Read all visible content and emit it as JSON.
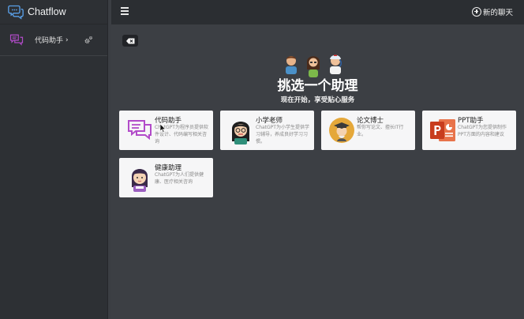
{
  "app": {
    "title": "Chatflow"
  },
  "sidebar": {
    "items": [
      {
        "label": "代码助手",
        "chevron": "›",
        "icon": "chat-bubbles-icon"
      }
    ]
  },
  "header": {
    "new_chat_label": "新的聊天"
  },
  "main": {
    "title": "挑选一个助理",
    "subtitle": "现在开始，享受贴心服务",
    "assistants": [
      {
        "name": "代码助手",
        "desc": "ChatGPT为程序员提供软件设计、代码编写相关咨询"
      },
      {
        "name": "小学老师",
        "desc": "ChatGPT为小学生提供学习辅导，养成良好学习习惯。"
      },
      {
        "name": "论文博士",
        "desc": "帮你写论文、擅长IT行业。"
      },
      {
        "name": "PPT助手",
        "desc": "ChatGPT为您提供制作PPT方面的内容和建议"
      },
      {
        "name": "健康助理",
        "desc": "ChatGPT为人们提供健康、医疗相关咨询"
      }
    ]
  },
  "colors": {
    "accent_purple": "#b24bc9",
    "ppt_red": "#d24625",
    "sidebar_bg": "#2d3034",
    "main_bg": "#3c3f44"
  }
}
